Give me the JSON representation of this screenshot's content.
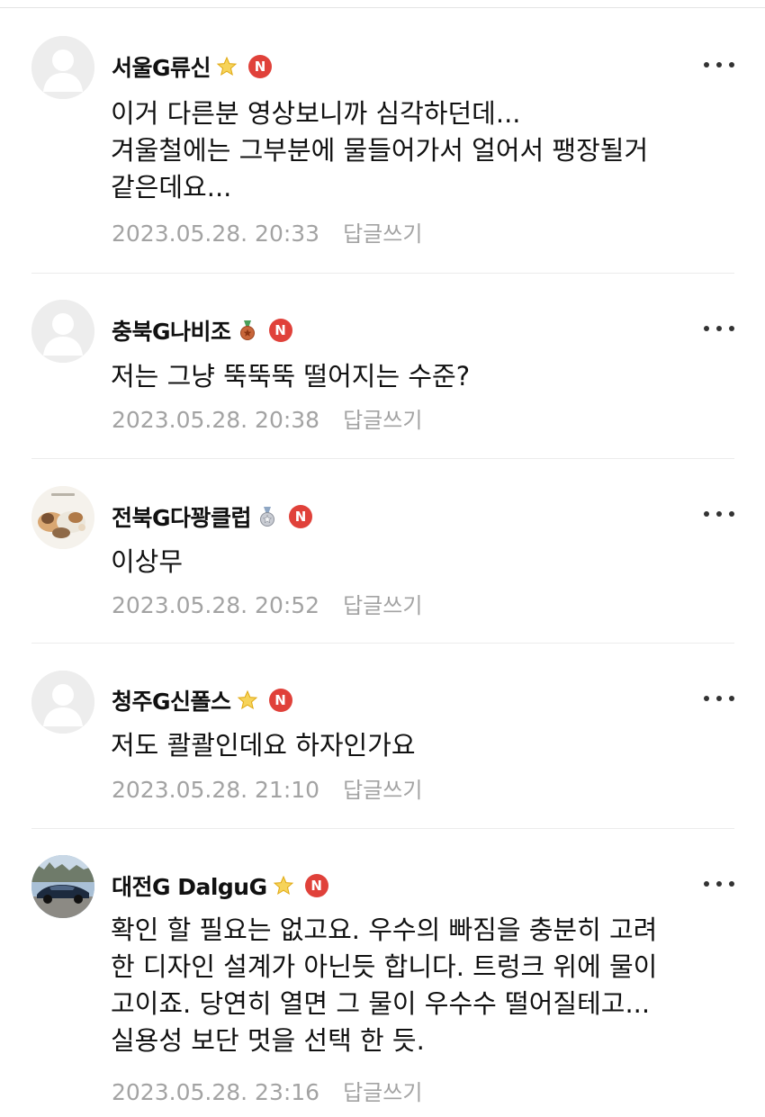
{
  "comments": [
    {
      "nickname": "서울G류신",
      "badge": "star-badge",
      "new_badge": "N",
      "avatar": "default-avatar",
      "text": "이거 다른분 영상보니까 심각하던데...\n겨울철에는 그부분에 물들어가서 얼어서 팽장될거\n같은데요...",
      "date": "2023.05.28. 20:33",
      "reply_label": "답글쓰기"
    },
    {
      "nickname": "충북G나비조",
      "badge": "bronze-medal-badge",
      "new_badge": "N",
      "avatar": "default-avatar",
      "text": "저는 그냥 뚝뚝뚝 떨어지는 수준?",
      "date": "2023.05.28. 20:38",
      "reply_label": "답글쓰기"
    },
    {
      "nickname": "전북G다꽝클럽",
      "badge": "silver-medal-badge",
      "new_badge": "N",
      "avatar": "cats-photo-avatar",
      "text": "이상무",
      "date": "2023.05.28. 20:52",
      "reply_label": "답글쓰기"
    },
    {
      "nickname": "청주G신폴스",
      "badge": "star-badge",
      "new_badge": "N",
      "avatar": "default-avatar",
      "text": "저도 콸콸인데요 하자인가요",
      "date": "2023.05.28. 21:10",
      "reply_label": "답글쓰기"
    },
    {
      "nickname": "대전G DalguG",
      "badge": "star-badge",
      "new_badge": "N",
      "avatar": "car-photo-avatar",
      "text": "확인 할 필요는 없고요. 우수의 빠짐을 충분히 고려\n한 디자인 설계가 아닌듯 합니다. 트렁크 위에 물이\n고이죠. 당연히 열면 그 물이 우수수 떨어질테고...\n실용성 보단 멋을 선택 한 듯.",
      "date": "2023.05.28. 23:16",
      "reply_label": "답글쓰기"
    }
  ],
  "colors": {
    "new_badge": "#e0413a",
    "meta_text": "#a3a3a3",
    "star": "#f3c623"
  }
}
